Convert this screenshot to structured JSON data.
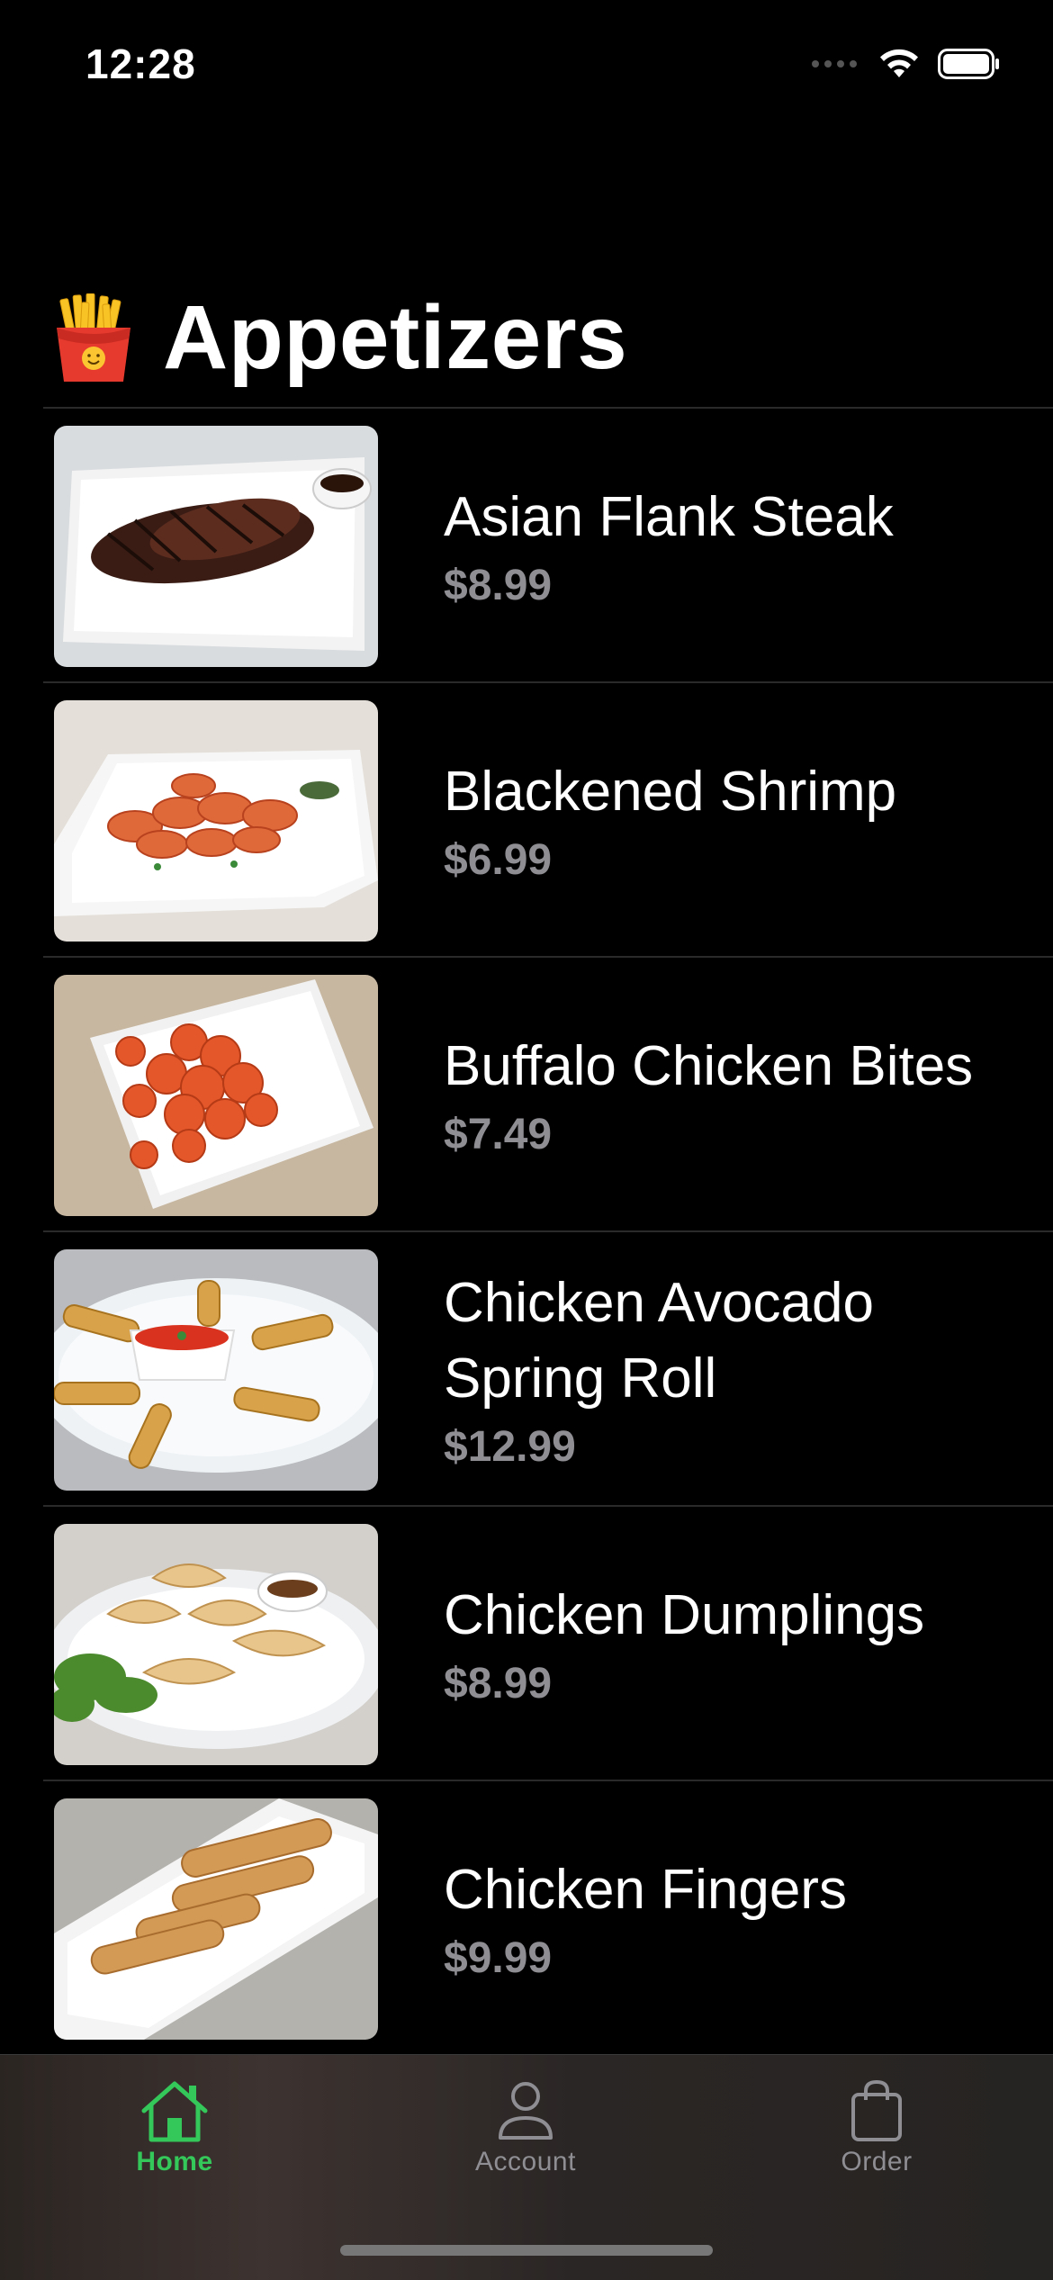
{
  "status_bar": {
    "time": "12:28"
  },
  "page": {
    "title": "Appetizers",
    "title_icon": "french-fries-emoji"
  },
  "menu_items": [
    {
      "name": "Asian Flank Steak",
      "price": "$8.99",
      "image": "flank-steak-photo"
    },
    {
      "name": "Blackened Shrimp",
      "price": "$6.99",
      "image": "shrimp-photo"
    },
    {
      "name": "Buffalo Chicken Bites",
      "price": "$7.49",
      "image": "chicken-bites-photo"
    },
    {
      "name": "Chicken Avocado Spring Roll",
      "price": "$12.99",
      "image": "spring-roll-photo"
    },
    {
      "name": "Chicken Dumplings",
      "price": "$8.99",
      "image": "dumplings-photo"
    },
    {
      "name": "Chicken Fingers",
      "price": "$9.99",
      "image": "chicken-fingers-photo"
    }
  ],
  "tab_bar": {
    "tabs": [
      {
        "label": "Home",
        "icon": "house-icon",
        "active": true
      },
      {
        "label": "Account",
        "icon": "person-icon",
        "active": false
      },
      {
        "label": "Order",
        "icon": "bag-icon",
        "active": false
      }
    ]
  },
  "colors": {
    "background": "#000000",
    "accent": "#34c759",
    "secondary_text": "#8e8e93",
    "separator": "#2a2a2a"
  }
}
